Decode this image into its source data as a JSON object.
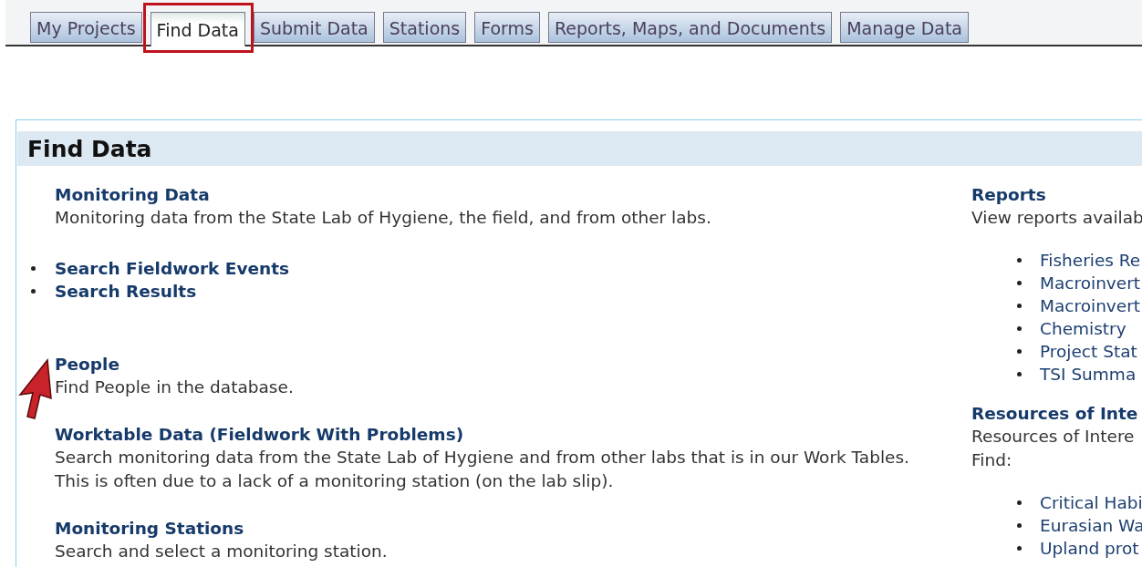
{
  "tabs": [
    {
      "label": "My Projects",
      "selected": false,
      "highlighted": false
    },
    {
      "label": "Find Data",
      "selected": true,
      "highlighted": true
    },
    {
      "label": "Submit Data",
      "selected": false,
      "highlighted": false
    },
    {
      "label": "Stations",
      "selected": false,
      "highlighted": false
    },
    {
      "label": "Forms",
      "selected": false,
      "highlighted": false
    },
    {
      "label": "Reports, Maps, and Documents",
      "selected": false,
      "highlighted": false
    },
    {
      "label": "Manage Data",
      "selected": false,
      "highlighted": false
    }
  ],
  "panel": {
    "title": "Find Data",
    "left_sections": [
      {
        "heading": "Monitoring Data",
        "description": "Monitoring data from the State Lab of Hygiene, the field, and from other labs.",
        "links": [
          "Search Fieldwork Events",
          "Search Results"
        ]
      },
      {
        "heading": "People",
        "description": "Find People in the database."
      },
      {
        "heading": "Worktable Data (Fieldwork With Problems)",
        "description": "Search monitoring data from the State Lab of Hygiene and from other labs that is in our Work Tables. This is often due to a lack of a monitoring station (on the lab slip)."
      },
      {
        "heading": "Monitoring Stations",
        "description": "Search and select a monitoring station."
      }
    ],
    "right_sections": [
      {
        "heading": "Reports",
        "description": [
          "View reports availab"
        ],
        "links": [
          "Fisheries Re",
          "Macroinvert",
          "Macroinvert",
          "Chemistry",
          "Project Stat",
          "TSI Summa"
        ]
      },
      {
        "heading": "Resources of Inte",
        "description": [
          "Resources of Intere",
          "Find:"
        ],
        "links": [
          "Critical Habi",
          "Eurasian Wa",
          "Upland prot"
        ]
      }
    ]
  }
}
